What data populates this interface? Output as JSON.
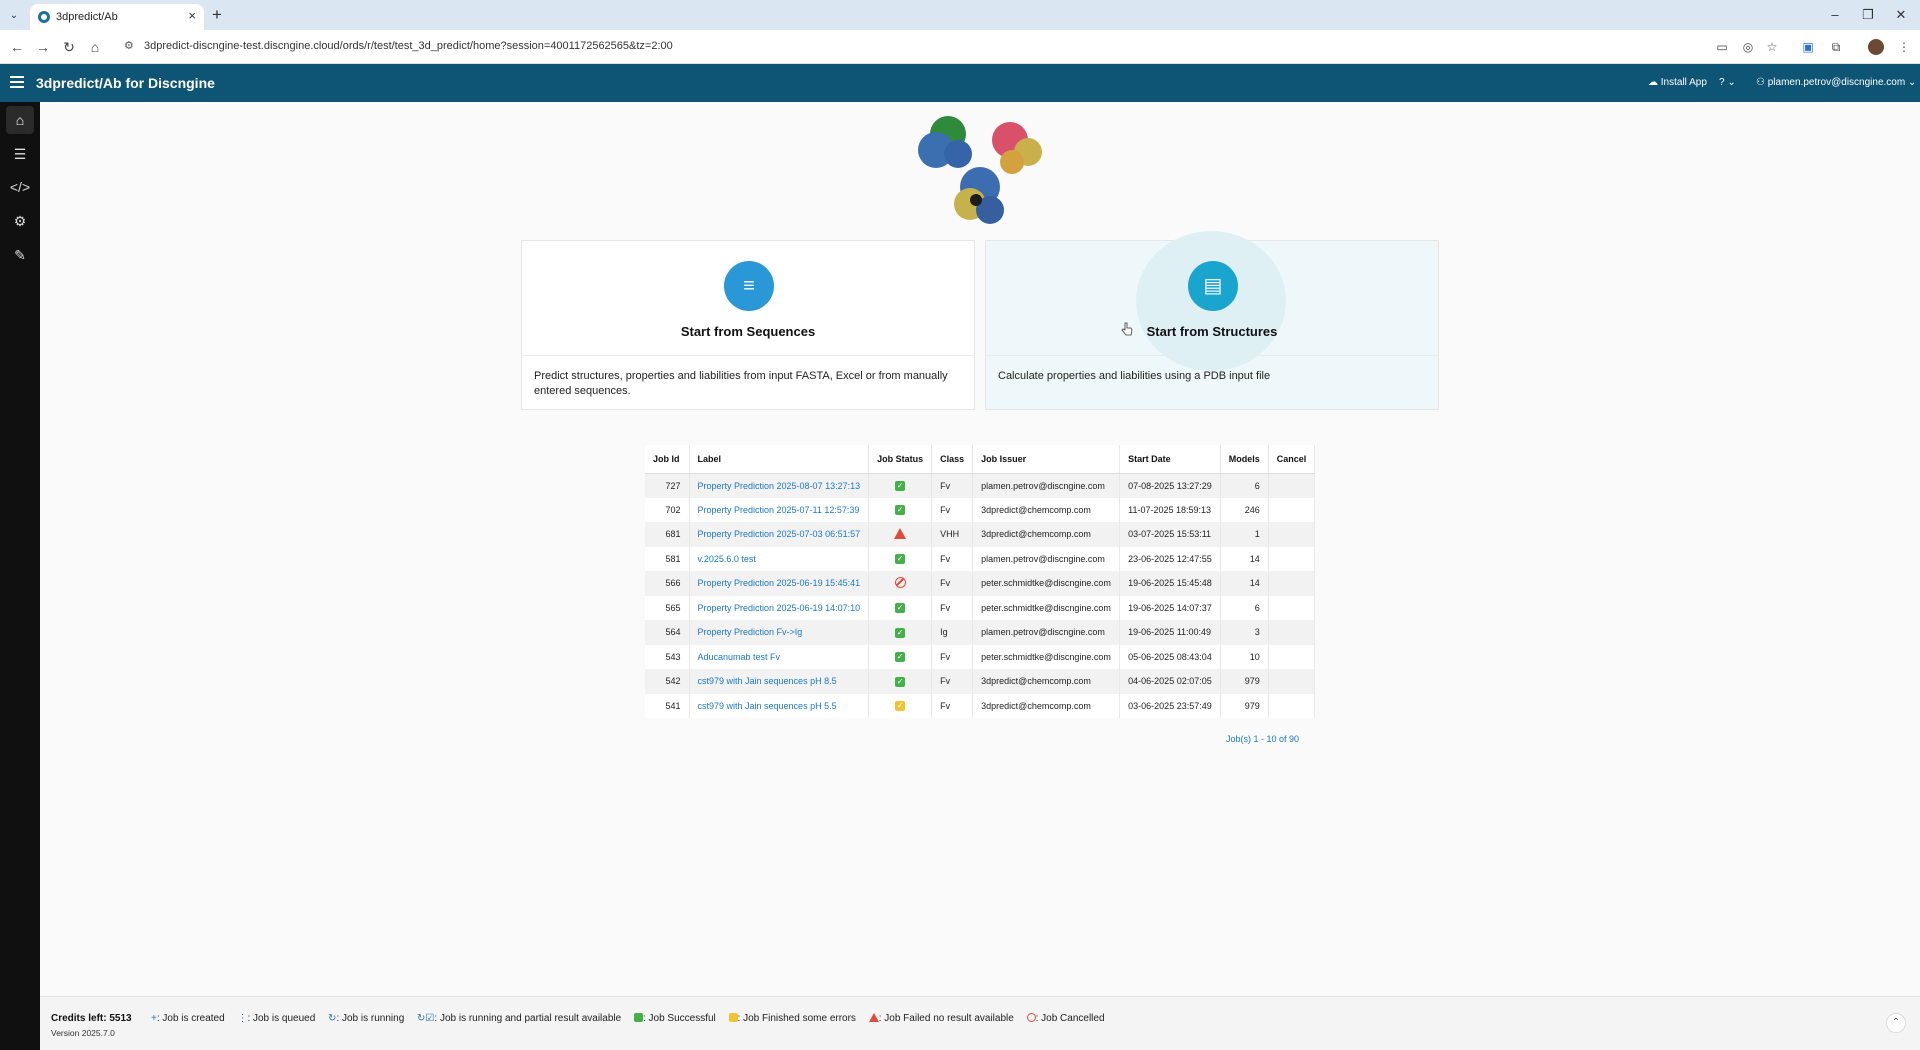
{
  "browser": {
    "tab_title": "3dpredict/Ab",
    "url": "3dpredict-discngine-test.discngine.cloud/ords/r/test/test_3d_predict/home?session=4001172562565&tz=2:00"
  },
  "header": {
    "title": "3dpredict/Ab for Discngine",
    "install_label": "Install App",
    "help_label": "?",
    "user_label": "plamen.petrov@discngine.com"
  },
  "sidenav": {
    "items": [
      "home",
      "jobs",
      "code",
      "settings",
      "admin"
    ]
  },
  "cards": [
    {
      "title": "Start from Sequences",
      "description": "Predict structures, properties and liabilities from input FASTA, Excel or from manually entered sequences.",
      "icon": "list-icon"
    },
    {
      "title": "Start from Structures",
      "description": "Calculate properties and liabilities using a PDB input file",
      "icon": "document-icon"
    }
  ],
  "jobs": {
    "columns": [
      "Job Id",
      "Label",
      "Job Status",
      "Class",
      "Job Issuer",
      "Start Date",
      "Models",
      "Cancel"
    ],
    "rows": [
      {
        "id": "727",
        "label": "Property Prediction 2025-08-07 13:27:13",
        "status": "success",
        "class": "Fv",
        "issuer": "plamen.petrov@discngine.com",
        "start": "07-08-2025 13:27:29",
        "models": "6"
      },
      {
        "id": "702",
        "label": "Property Prediction 2025-07-11 12:57:39",
        "status": "success",
        "class": "Fv",
        "issuer": "3dpredict@chemcomp.com",
        "start": "11-07-2025 18:59:13",
        "models": "246"
      },
      {
        "id": "681",
        "label": "Property Prediction 2025-07-03 06:51:57",
        "status": "failed",
        "class": "VHH",
        "issuer": "3dpredict@chemcomp.com",
        "start": "03-07-2025 15:53:11",
        "models": "1"
      },
      {
        "id": "581",
        "label": "v.2025.6.0 test",
        "status": "success",
        "class": "Fv",
        "issuer": "plamen.petrov@discngine.com",
        "start": "23-06-2025 12:47:55",
        "models": "14"
      },
      {
        "id": "566",
        "label": "Property Prediction 2025-06-19 15:45:41",
        "status": "cancelled",
        "class": "Fv",
        "issuer": "peter.schmidtke@discngine.com",
        "start": "19-06-2025 15:45:48",
        "models": "14"
      },
      {
        "id": "565",
        "label": "Property Prediction 2025-06-19 14:07:10",
        "status": "success",
        "class": "Fv",
        "issuer": "peter.schmidtke@discngine.com",
        "start": "19-06-2025 14:07:37",
        "models": "6"
      },
      {
        "id": "564",
        "label": "Property Prediction Fv->Ig",
        "status": "success",
        "class": "Ig",
        "issuer": "plamen.petrov@discngine.com",
        "start": "19-06-2025 11:00:49",
        "models": "3"
      },
      {
        "id": "543",
        "label": "Aducanumab test Fv",
        "status": "success",
        "class": "Fv",
        "issuer": "peter.schmidtke@discngine.com",
        "start": "05-06-2025 08:43:04",
        "models": "10"
      },
      {
        "id": "542",
        "label": "cst979 with Jain sequences pH 8.5",
        "status": "success",
        "class": "Fv",
        "issuer": "3dpredict@chemcomp.com",
        "start": "04-06-2025 02:07:05",
        "models": "979"
      },
      {
        "id": "541",
        "label": "cst979 with Jain sequences pH 5.5",
        "status": "warning",
        "class": "Fv",
        "issuer": "3dpredict@chemcomp.com",
        "start": "03-06-2025 23:57:49",
        "models": "979"
      }
    ],
    "pagination": "Job(s) 1 - 10 of 90"
  },
  "footer": {
    "credits": "Credits left: 5513",
    "version": "Version 2025.7.0",
    "legend": {
      "created": ": Job is created",
      "queued": ": Job is queued",
      "running": ": Job is running",
      "partial": ": Job is running and partial result available",
      "successful": ": Job Successful",
      "finished_errors": ": Job Finished some errors",
      "failed": ": Job Failed no result available",
      "cancelled": ": Job Cancelled"
    }
  },
  "colors": {
    "header_bg": "#0e5474",
    "accent": "#1aa5cf",
    "link": "#1b78c6",
    "success": "#45b04a",
    "warning": "#f1c232",
    "error": "#e24b3a"
  }
}
